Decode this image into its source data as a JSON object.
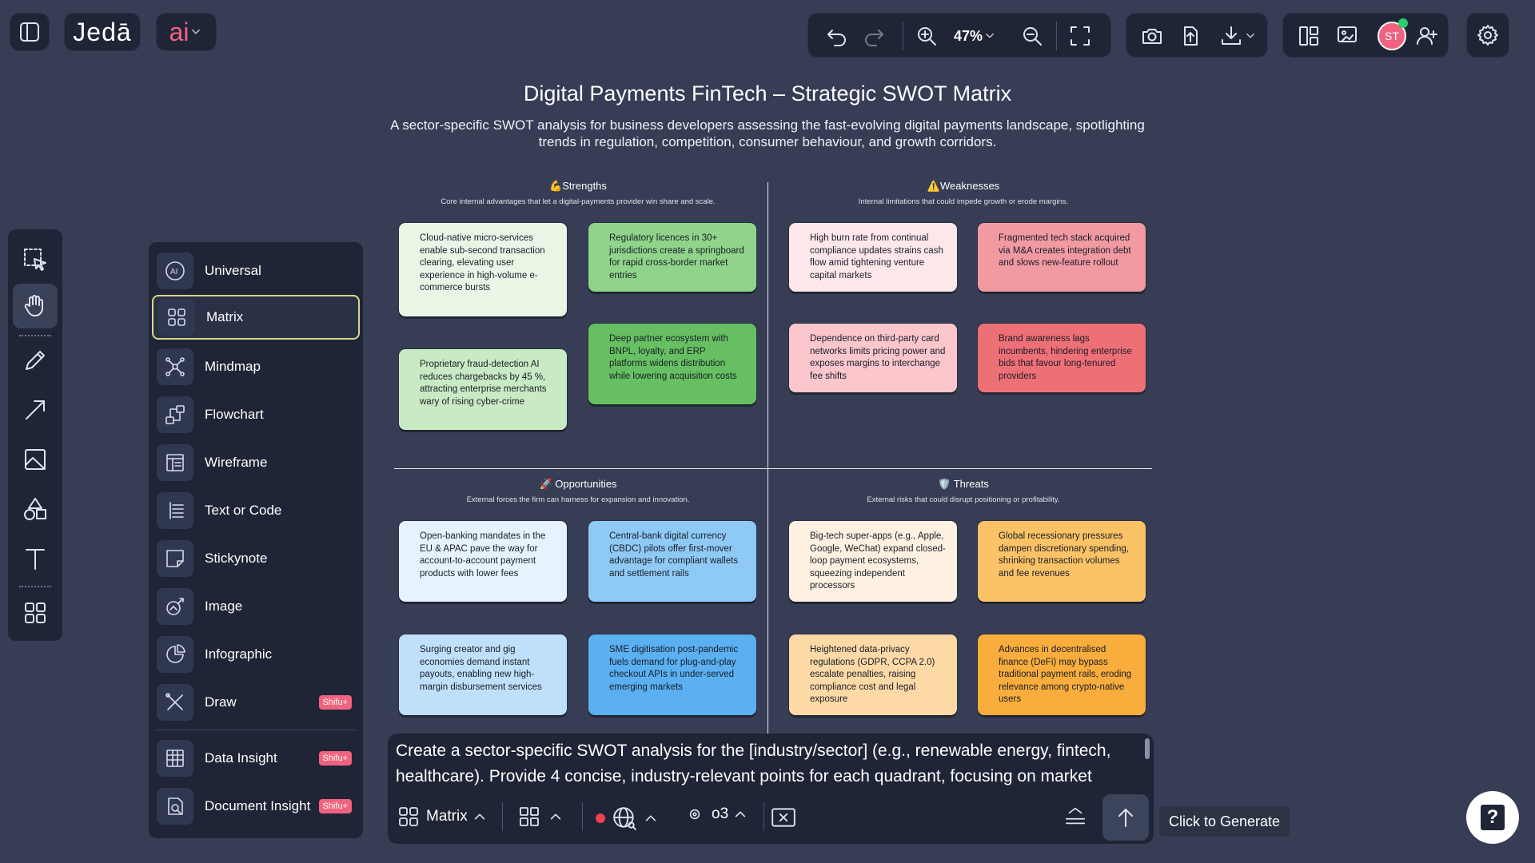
{
  "app": {
    "logo": "Jedā",
    "ai_label": "ai"
  },
  "toolbar": {
    "zoom_level": "47%",
    "avatar_initials": "ST"
  },
  "canvas": {
    "title": "Digital Payments FinTech – Strategic SWOT Matrix",
    "subtitle": "A sector-specific SWOT analysis for business developers assessing the fast-evolving digital payments landscape, spotlighting trends in regulation, competition, consumer behaviour, and growth corridors.",
    "quadrants": {
      "strengths": {
        "title": "💪Strengths",
        "subtitle": "Core internal advantages that let a digital-payments provider win share and scale.",
        "cards": [
          "Cloud-native micro-services enable sub-second transaction clearing, elevating user experience in high-volume e-commerce bursts",
          "Regulatory licences in 30+ jurisdictions create a springboard for rapid cross-border market entries",
          "Proprietary fraud-detection AI reduces chargebacks by 45 %, attracting enterprise merchants wary of rising cyber-crime",
          "Deep partner ecosystem with BNPL, loyalty, and ERP platforms widens distribution while lowering acquisition costs"
        ]
      },
      "weaknesses": {
        "title": "⚠️Weaknesses",
        "subtitle": "Internal limitations that could impede growth or erode margins.",
        "cards": [
          "High burn rate from continual compliance updates strains cash flow amid tightening venture capital markets",
          "Fragmented tech stack acquired via M&A creates integration debt and slows new-feature rollout",
          "Dependence on third-party card networks limits pricing power and exposes margins to interchange fee shifts",
          "Brand awareness lags incumbents, hindering enterprise bids that favour long-tenured providers"
        ]
      },
      "opportunities": {
        "title": "🚀 Opportunities",
        "subtitle": "External forces the firm can harness for expansion and innovation.",
        "cards": [
          "Open-banking mandates in the EU & APAC pave the way for account-to-account payment products with lower fees",
          "Central-bank digital currency (CBDC) pilots offer first-mover advantage for compliant wallets and settlement rails",
          "Surging creator and gig economies demand instant payouts, enabling new high-margin disbursement services",
          "SME digitisation post-pandemic fuels demand for plug-and-play checkout APIs in under-served emerging markets"
        ]
      },
      "threats": {
        "title": "🛡️ Threats",
        "subtitle": "External risks that could disrupt positioning or profitability.",
        "cards": [
          "Big-tech super-apps (e.g., Apple, Google, WeChat) expand closed-loop payment ecosystems, squeezing independent processors",
          "Global recessionary pressures dampen discretionary spending, shrinking transaction volumes and fee revenues",
          "Heightened data-privacy regulations (GDPR, CCPA 2.0) escalate penalties, raising compliance cost and legal exposure",
          "Advances in decentralised finance (DeFi) may bypass traditional payment rails, eroding relevance among crypto-native users"
        ]
      }
    },
    "card_colors": {
      "strengths": [
        "#e9f6e6",
        "#8fd48a",
        "#c9ebc4",
        "#66c062"
      ],
      "weaknesses": [
        "#fde7ea",
        "#f29aa2",
        "#fbc6cc",
        "#ee7077"
      ],
      "opportunities": [
        "#e6f2fd",
        "#8fcaf6",
        "#bfe0fa",
        "#5ab0f1"
      ],
      "threats": [
        "#fef1e1",
        "#fbc266",
        "#fdd9a6",
        "#f9ad3c"
      ]
    }
  },
  "menu": {
    "items": [
      {
        "label": "Universal",
        "icon": "ai-globe-icon",
        "badge": ""
      },
      {
        "label": "Matrix",
        "icon": "matrix-icon",
        "badge": ""
      },
      {
        "label": "Mindmap",
        "icon": "mindmap-icon",
        "badge": ""
      },
      {
        "label": "Flowchart",
        "icon": "flowchart-icon",
        "badge": ""
      },
      {
        "label": "Wireframe",
        "icon": "wireframe-icon",
        "badge": ""
      },
      {
        "label": "Text or Code",
        "icon": "text-code-icon",
        "badge": ""
      },
      {
        "label": "Stickynote",
        "icon": "stickynote-icon",
        "badge": ""
      },
      {
        "label": "Image",
        "icon": "image-icon",
        "badge": ""
      },
      {
        "label": "Infographic",
        "icon": "infographic-icon",
        "badge": ""
      },
      {
        "label": "Draw",
        "icon": "draw-icon",
        "badge": "Shifu+"
      },
      {
        "label": "Data Insight",
        "icon": "data-insight-icon",
        "badge": "Shifu+"
      },
      {
        "label": "Document Insight",
        "icon": "document-insight-icon",
        "badge": "Shifu+"
      }
    ]
  },
  "prompt": {
    "text": "Create a sector-specific SWOT analysis for the [industry/sector] (e.g., renewable energy, fintech, healthcare). Provide 4 concise, industry-relevant points for each quadrant, focusing on market",
    "mode_label": "Matrix",
    "model_label": "o3",
    "tooltip": "Click to Generate"
  }
}
